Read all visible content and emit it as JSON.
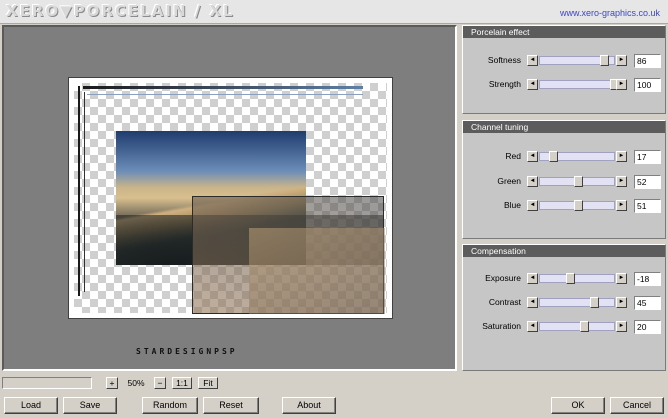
{
  "header": {
    "title": "XERO▼PORCELAIN / XL",
    "link": "www.xero-graphics.co.uk"
  },
  "preview": {
    "signature": "STARDESIGNPSP"
  },
  "panels": {
    "porcelain": {
      "title": "Porcelain effect",
      "rows": [
        {
          "label": "Softness",
          "value": "86",
          "fraction": 0.86
        },
        {
          "label": "Strength",
          "value": "100",
          "fraction": 1.0
        }
      ]
    },
    "channel": {
      "title": "Channel tuning",
      "rows": [
        {
          "label": "Red",
          "value": "17",
          "fraction": 0.17
        },
        {
          "label": "Green",
          "value": "52",
          "fraction": 0.52
        },
        {
          "label": "Blue",
          "value": "51",
          "fraction": 0.51
        }
      ]
    },
    "compensation": {
      "title": "Compensation",
      "rows": [
        {
          "label": "Exposure",
          "value": "-18",
          "fraction": 0.41
        },
        {
          "label": "Contrast",
          "value": "45",
          "fraction": 0.725
        },
        {
          "label": "Saturation",
          "value": "20",
          "fraction": 0.6
        }
      ]
    }
  },
  "zoom": {
    "progress": 0.0,
    "plus": "+",
    "value": "50%",
    "minus": "−",
    "one_to_one": "1:1",
    "fit": "Fit"
  },
  "buttons": {
    "load": "Load",
    "save": "Save",
    "random": "Random",
    "reset": "Reset",
    "about": "About",
    "ok": "OK",
    "cancel": "Cancel"
  },
  "icons": {
    "arrow_left": "◄",
    "arrow_right": "►"
  },
  "colors": {
    "panel_title_bg": "#5c5c5c",
    "slider_track": "#e2e2f4",
    "link": "#3a48c8"
  }
}
